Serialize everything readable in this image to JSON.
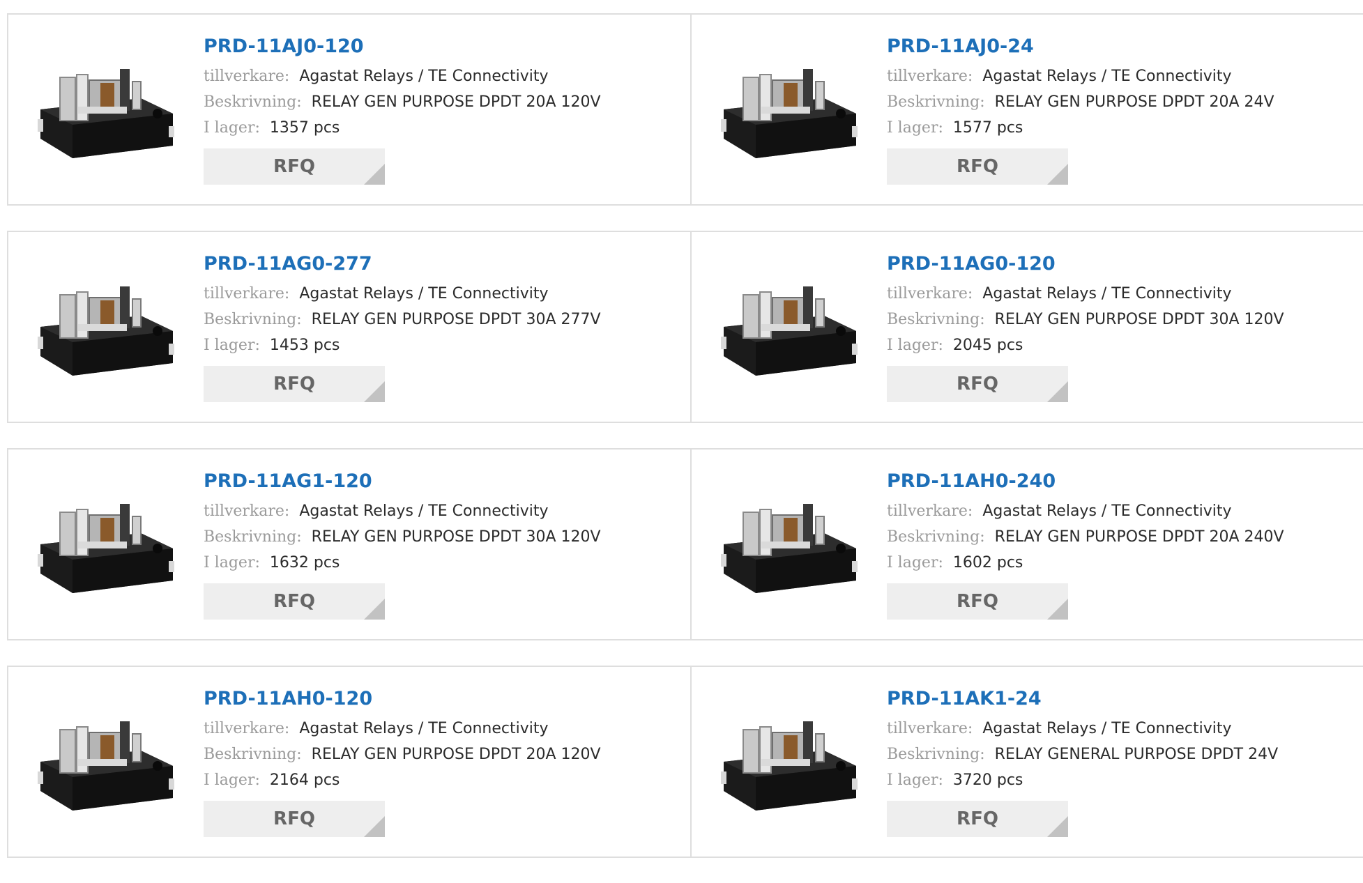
{
  "labels": {
    "manufacturer": "tillverkare:",
    "description": "Beskrivning:",
    "stock": "I lager:"
  },
  "rfq_label": "RFQ",
  "colors": {
    "title": "#1d6fb8",
    "label": "#9a9a9a",
    "value": "#2b2b2b",
    "border": "#dedede",
    "button_bg": "#eeeeee",
    "button_corner": "#c2c2c2"
  },
  "image_icon": "relay-image",
  "products": [
    {
      "part": "PRD-11AJ0-120",
      "manufacturer": "Agastat Relays / TE Connectivity",
      "description": "RELAY GEN PURPOSE DPDT 20A 120V",
      "stock": "1357 pcs"
    },
    {
      "part": "PRD-11AJ0-24",
      "manufacturer": "Agastat Relays / TE Connectivity",
      "description": "RELAY GEN PURPOSE DPDT 20A 24V",
      "stock": "1577 pcs"
    },
    {
      "part": "PRD-11AG0-277",
      "manufacturer": "Agastat Relays / TE Connectivity",
      "description": "RELAY GEN PURPOSE DPDT 30A 277V",
      "stock": "1453 pcs"
    },
    {
      "part": "PRD-11AG0-120",
      "manufacturer": "Agastat Relays / TE Connectivity",
      "description": "RELAY GEN PURPOSE DPDT 30A 120V",
      "stock": "2045 pcs"
    },
    {
      "part": "PRD-11AG1-120",
      "manufacturer": "Agastat Relays / TE Connectivity",
      "description": "RELAY GEN PURPOSE DPDT 30A 120V",
      "stock": "1632 pcs"
    },
    {
      "part": "PRD-11AH0-240",
      "manufacturer": "Agastat Relays / TE Connectivity",
      "description": "RELAY GEN PURPOSE DPDT 20A 240V",
      "stock": "1602 pcs"
    },
    {
      "part": "PRD-11AH0-120",
      "manufacturer": "Agastat Relays / TE Connectivity",
      "description": "RELAY GEN PURPOSE DPDT 20A 120V",
      "stock": "2164 pcs"
    },
    {
      "part": "PRD-11AK1-24",
      "manufacturer": "Agastat Relays / TE Connectivity",
      "description": "RELAY GENERAL PURPOSE DPDT 24V",
      "stock": "3720 pcs"
    }
  ]
}
